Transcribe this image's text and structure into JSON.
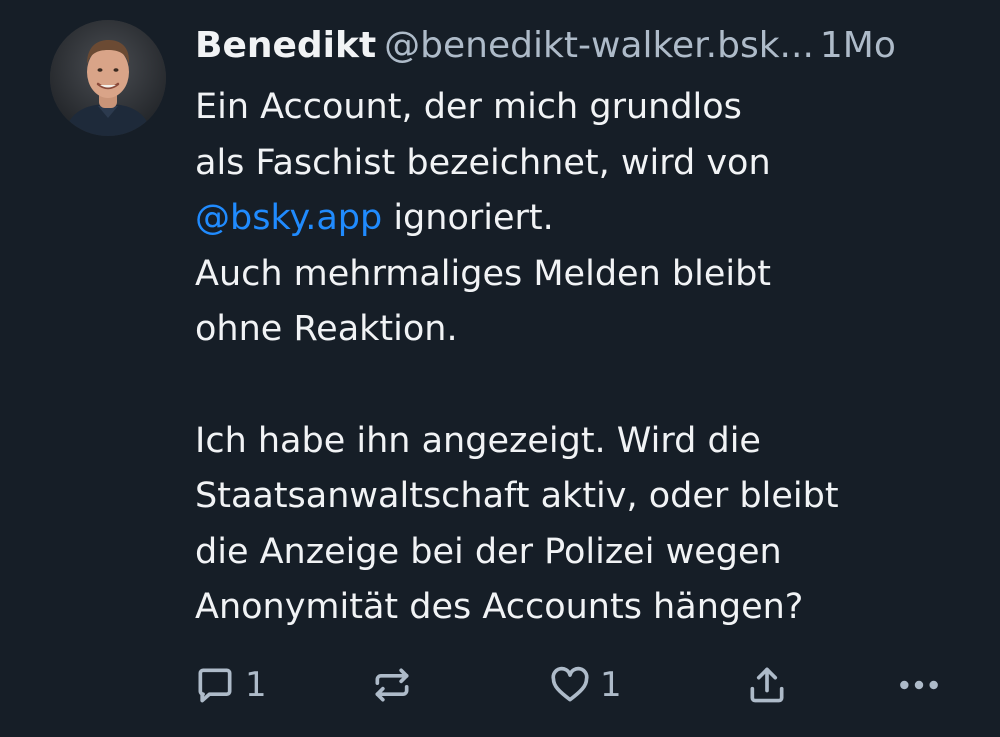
{
  "post": {
    "author": {
      "display_name": "Benedikt",
      "handle": "@benedikt-walker.bsk...",
      "avatar_icon": "avatar-photo"
    },
    "timestamp": "1Mo",
    "text": {
      "line1": "Ein Account, der mich grundlos",
      "line2": "als Faschist bezeichnet, wird von",
      "line3_mention": "@bsky.app",
      "line3_rest": " ignoriert.",
      "line4": "Auch mehrmaliges Melden bleibt",
      "line5": "ohne Reaktion.",
      "line6": "Ich habe ihn angezeigt. Wird die",
      "line7": "Staatsanwaltschaft aktiv, oder bleibt",
      "line8": "die Anzeige bei der Polizei wegen",
      "line9": "Anonymität des Accounts hängen?"
    },
    "actions": {
      "reply_count": "1",
      "like_count": "1",
      "reply_icon": "reply-icon",
      "repost_icon": "repost-icon",
      "like_icon": "heart-icon",
      "share_icon": "share-icon",
      "more_icon": "more-icon"
    }
  },
  "colors": {
    "background": "#161e27",
    "text": "#f1f3f5",
    "muted": "#aebbc9",
    "link": "#208bfe"
  }
}
